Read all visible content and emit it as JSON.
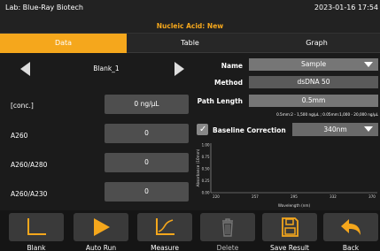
{
  "header": {
    "lab": "Lab: Blue-Ray Biotech",
    "datetime": "2023-01-16 17:54",
    "mode": "Nucleic Acid: New"
  },
  "tabs": [
    {
      "label": "Data",
      "active": true
    },
    {
      "label": "Table",
      "active": false
    },
    {
      "label": "Graph",
      "active": false
    }
  ],
  "sample_nav": {
    "label": "Blank_1"
  },
  "measurements": [
    {
      "label": "[conc.]",
      "value": "0 ng/µL"
    },
    {
      "label": "A260",
      "value": "0"
    },
    {
      "label": "A260/A280",
      "value": "0"
    },
    {
      "label": "A260/A230",
      "value": "0"
    }
  ],
  "settings": {
    "name_label": "Name",
    "name_value": "Sample",
    "method_label": "Method",
    "method_value": "dsDNA 50",
    "path_label": "Path Length",
    "path_value": "0.5mm",
    "path_hint": "0.5mm:2 - 1,500 ng/µL ; 0.05mm:1,000 - 20,000 ng/µL",
    "baseline_label": "Baseline Correction",
    "baseline_checked": true,
    "baseline_value": "340nm"
  },
  "chart_data": {
    "type": "line",
    "xlabel": "Wavelength (nm)",
    "ylabel": "Absorbance (10mm)",
    "x_ticks": [
      "220",
      "257",
      "295",
      "332",
      "370"
    ],
    "y_ticks": [
      "0.00",
      "0.25",
      "0.50",
      "0.75",
      "1.00"
    ],
    "xlim": [
      220,
      370
    ],
    "ylim": [
      0,
      1
    ],
    "grid": false,
    "series": []
  },
  "toolbar": [
    {
      "label": "Blank",
      "icon": "blank-chart-icon",
      "enabled": true
    },
    {
      "label": "Auto Run",
      "icon": "play-icon",
      "enabled": true
    },
    {
      "label": "Measure",
      "icon": "measure-chart-icon",
      "enabled": true
    },
    {
      "label": "Delete",
      "icon": "trash-icon",
      "enabled": false
    },
    {
      "label": "Save Result",
      "icon": "save-icon",
      "enabled": true
    },
    {
      "label": "Back",
      "icon": "back-arrow-icon",
      "enabled": true
    }
  ],
  "colors": {
    "accent": "#f5a71c",
    "background": "#1b1b1b",
    "field": "#4e4e4e"
  }
}
